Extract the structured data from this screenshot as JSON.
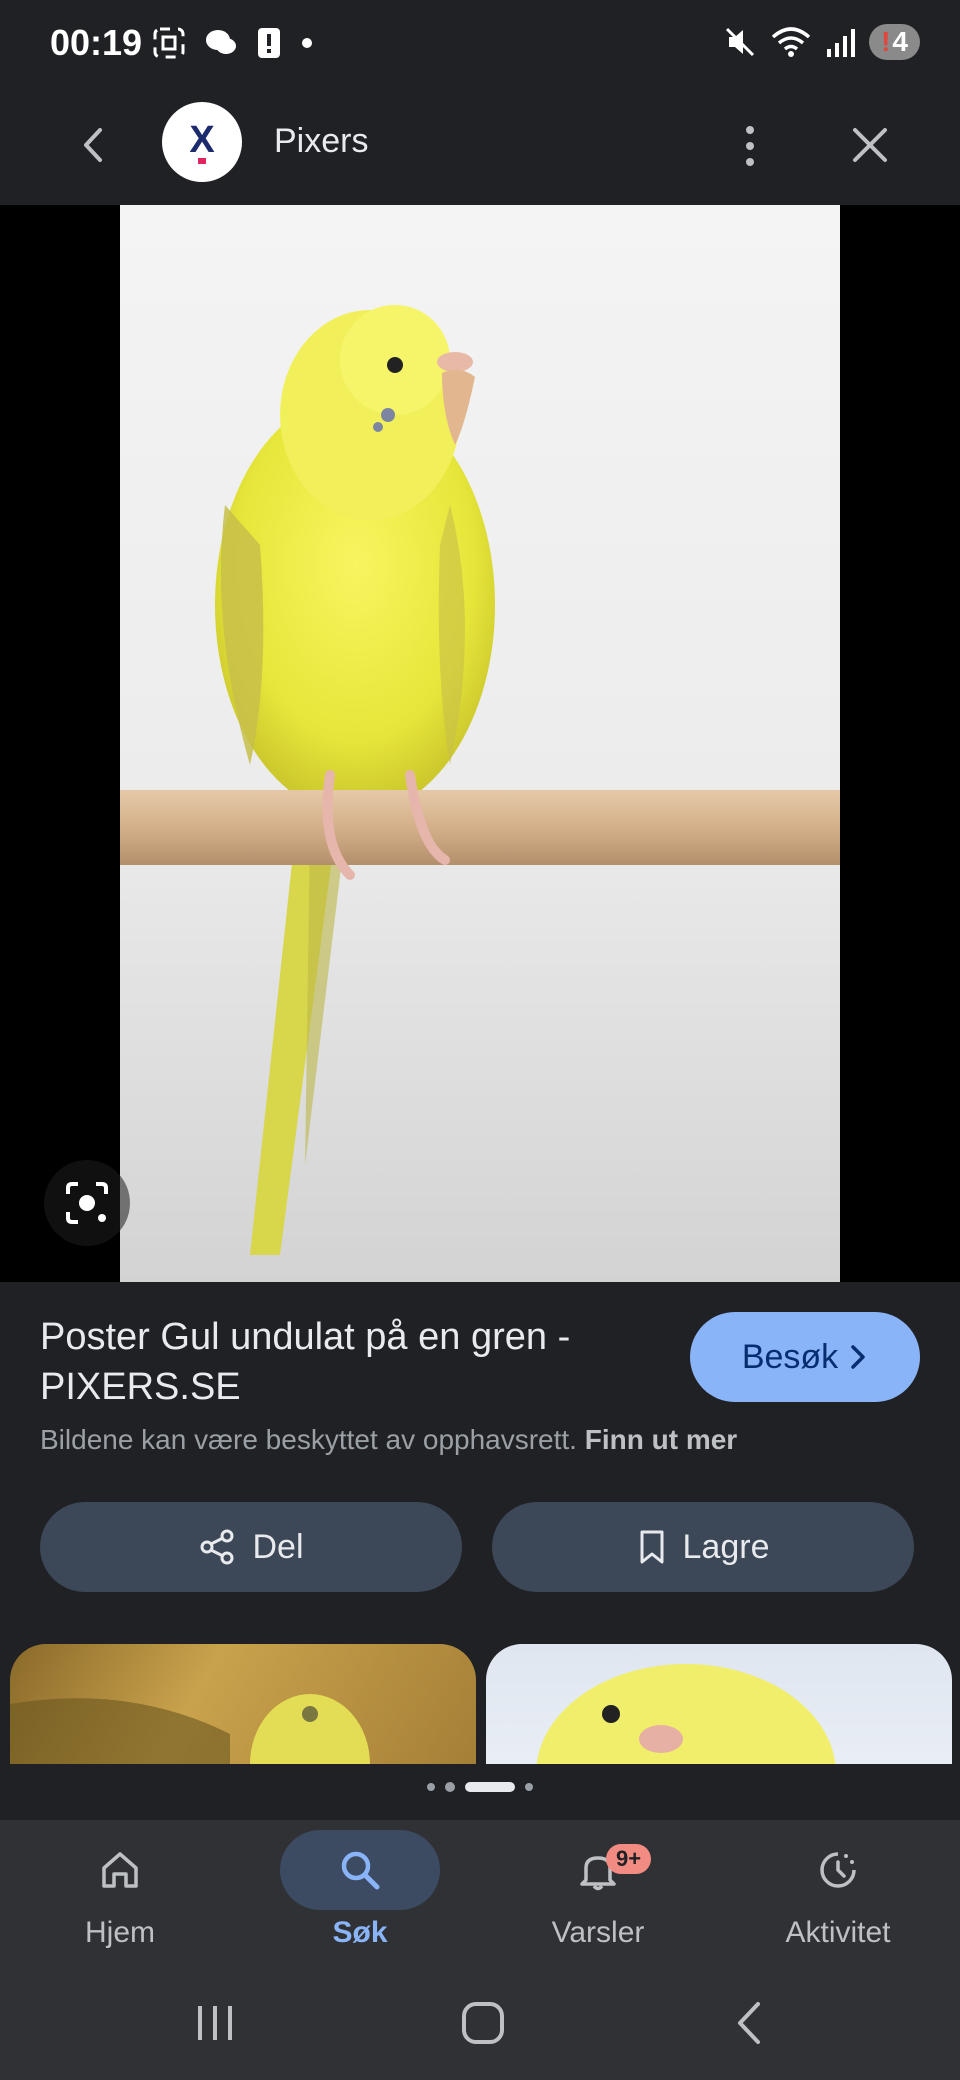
{
  "status_bar": {
    "time": "00:19",
    "notification_count": "4"
  },
  "app_bar": {
    "site_name": "Pixers",
    "logo_letter": "X"
  },
  "result": {
    "title": "Poster Gul undulat på en gren - PIXERS.SE",
    "visit_label": "Besøk",
    "copyright_text": "Bildene kan være beskyttet av opphavsrett.",
    "learn_more": "Finn ut mer",
    "share_label": "Del",
    "save_label": "Lagre"
  },
  "pager": {
    "count": 4,
    "active": 2
  },
  "bottom_nav": {
    "items": [
      {
        "label": "Hjem",
        "icon": "home-icon"
      },
      {
        "label": "Søk",
        "icon": "search-icon",
        "active": true
      },
      {
        "label": "Varsler",
        "icon": "bell-icon",
        "badge": "9+"
      },
      {
        "label": "Aktivitet",
        "icon": "activity-icon"
      }
    ]
  },
  "colors": {
    "accent": "#8ab4f8",
    "surface": "#202124",
    "button": "#3c4758",
    "badge": "#f28b82"
  }
}
